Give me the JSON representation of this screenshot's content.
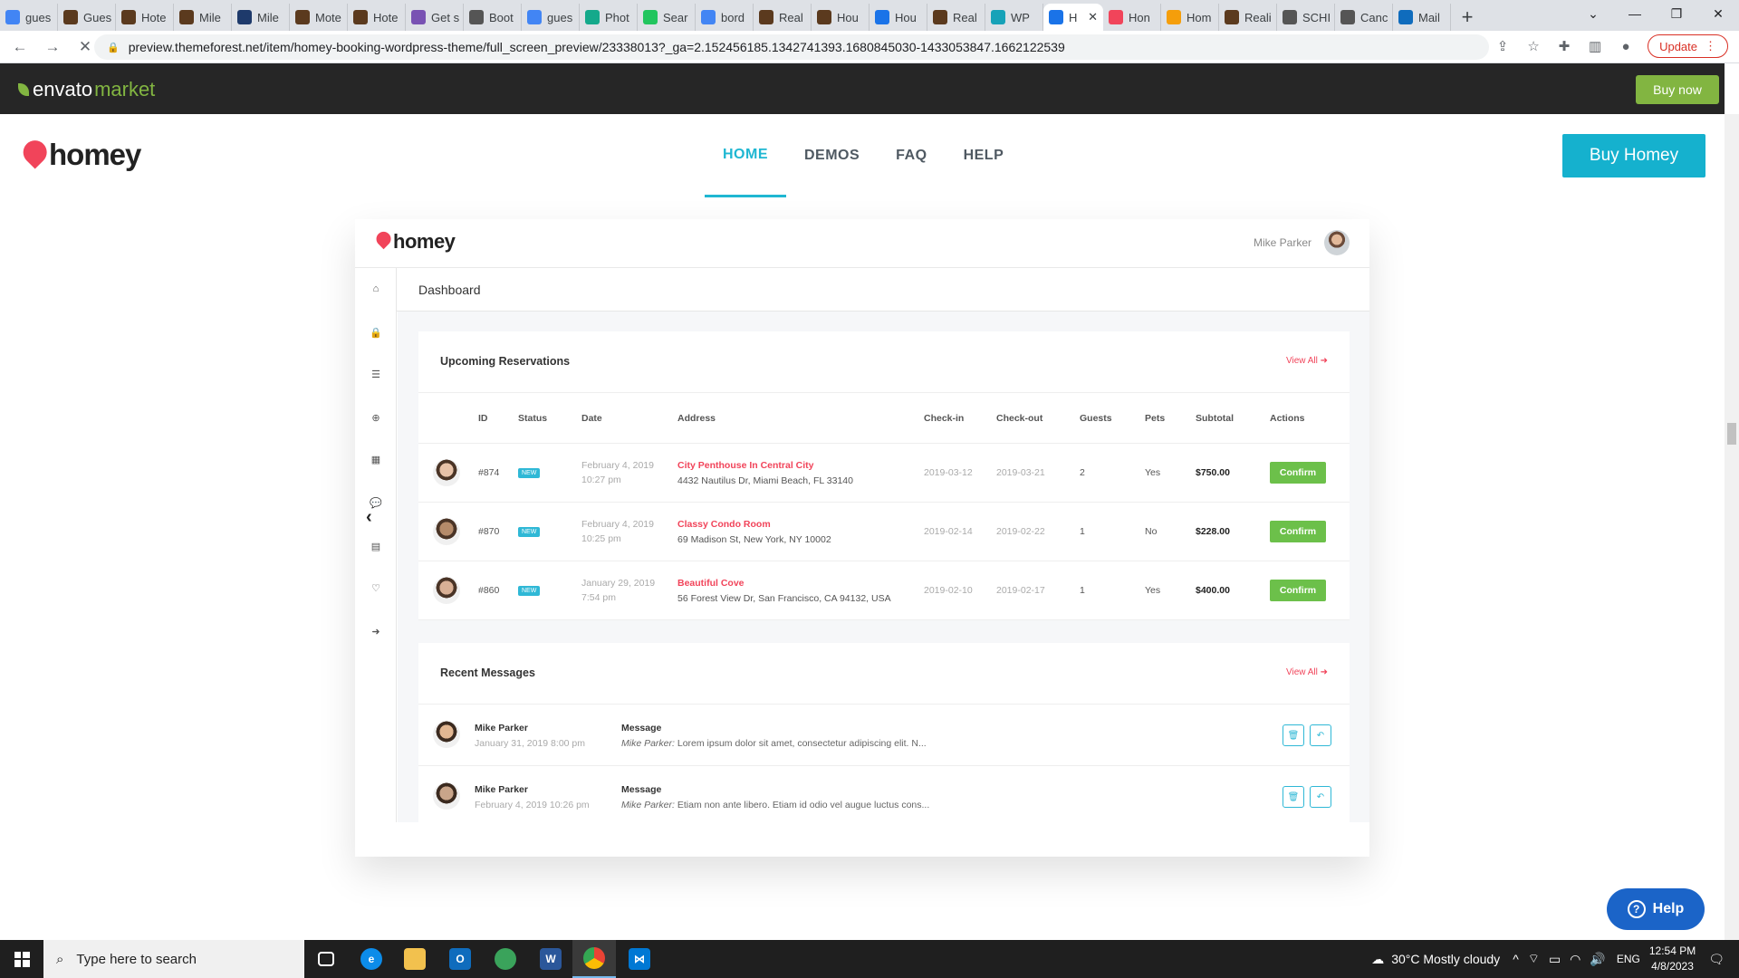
{
  "browser": {
    "tabs": [
      {
        "label": "gues",
        "icon": "google-icon",
        "color": "#4285f4"
      },
      {
        "label": "Gues",
        "icon": "site-icon",
        "color": "#5b3a1e"
      },
      {
        "label": "Hote",
        "icon": "site-icon",
        "color": "#5b3a1e"
      },
      {
        "label": "Mile",
        "icon": "site-icon",
        "color": "#5b3a1e"
      },
      {
        "label": "Mile",
        "icon": "site-icon",
        "color": "#1e3a6b"
      },
      {
        "label": "Mote",
        "icon": "site-icon",
        "color": "#5b3a1e"
      },
      {
        "label": "Hote",
        "icon": "site-icon",
        "color": "#5b3a1e"
      },
      {
        "label": "Get s",
        "icon": "bootstrap-icon",
        "color": "#7952b3"
      },
      {
        "label": "Boot",
        "icon": "globe-icon",
        "color": "#555555"
      },
      {
        "label": "gues",
        "icon": "google-icon",
        "color": "#4285f4"
      },
      {
        "label": "Phot",
        "icon": "site-icon",
        "color": "#14a98b"
      },
      {
        "label": "Sear",
        "icon": "site-icon",
        "color": "#22c55e"
      },
      {
        "label": "bord",
        "icon": "google-icon",
        "color": "#4285f4"
      },
      {
        "label": "Real",
        "icon": "site-icon",
        "color": "#5b3a1e"
      },
      {
        "label": "Hou",
        "icon": "site-icon",
        "color": "#5b3a1e"
      },
      {
        "label": "Hou",
        "icon": "site-icon",
        "color": "#1a73e8"
      },
      {
        "label": "Real",
        "icon": "site-icon",
        "color": "#5b3a1e"
      },
      {
        "label": "WP",
        "icon": "site-icon",
        "color": "#17a2b8"
      },
      {
        "label": "H",
        "icon": "loading-icon",
        "color": "#1a73e8",
        "active": true
      },
      {
        "label": "Hon",
        "icon": "heart-icon",
        "color": "#f1445a"
      },
      {
        "label": "Hom",
        "icon": "heart-icon",
        "color": "#f59e0b"
      },
      {
        "label": "Reali",
        "icon": "site-icon",
        "color": "#5b3a1e"
      },
      {
        "label": "SCHI",
        "icon": "globe-icon",
        "color": "#555555"
      },
      {
        "label": "Canc",
        "icon": "globe-icon",
        "color": "#555555"
      },
      {
        "label": "Mail",
        "icon": "outlook-icon",
        "color": "#0f6cbd"
      }
    ],
    "url": "preview.themeforest.net/item/homey-booking-wordpress-theme/full_screen_preview/23338013?_ga=2.152456185.1342741393.1680845030-1433053847.1662122539",
    "update_label": "Update"
  },
  "envato": {
    "logo_main": "envato",
    "logo_sub": "market",
    "buy_now": "Buy now"
  },
  "site": {
    "logo": "homey",
    "nav": [
      "HOME",
      "DEMOS",
      "FAQ",
      "HELP"
    ],
    "active_nav": "HOME",
    "cta": "Buy Homey"
  },
  "dashboard": {
    "logo": "homey",
    "user_name": "Mike Parker",
    "title": "Dashboard",
    "reservations": {
      "title": "Upcoming Reservations",
      "view_all": "View All",
      "columns": [
        "ID",
        "Status",
        "Date",
        "Address",
        "Check-in",
        "Check-out",
        "Guests",
        "Pets",
        "Subtotal",
        "Actions"
      ],
      "rows": [
        {
          "id": "#874",
          "status": "NEW",
          "date": "February 4, 2019",
          "time": "10:27 pm",
          "name": "City Penthouse In Central City",
          "address": "4432 Nautilus Dr, Miami Beach, FL 33140",
          "checkin": "2019-03-12",
          "checkout": "2019-03-21",
          "guests": "2",
          "pets": "Yes",
          "subtotal": "$750.00",
          "action": "Confirm"
        },
        {
          "id": "#870",
          "status": "NEW",
          "date": "February 4, 2019",
          "time": "10:25 pm",
          "name": "Classy Condo Room",
          "address": "69 Madison St, New York, NY 10002",
          "checkin": "2019-02-14",
          "checkout": "2019-02-22",
          "guests": "1",
          "pets": "No",
          "subtotal": "$228.00",
          "action": "Confirm"
        },
        {
          "id": "#860",
          "status": "NEW",
          "date": "January 29, 2019",
          "time": "7:54 pm",
          "name": "Beautiful Cove",
          "address": "56 Forest View Dr, San Francisco, CA 94132, USA",
          "checkin": "2019-02-10",
          "checkout": "2019-02-17",
          "guests": "1",
          "pets": "Yes",
          "subtotal": "$400.00",
          "action": "Confirm"
        }
      ]
    },
    "messages": {
      "title": "Recent Messages",
      "view_all": "View All",
      "rows": [
        {
          "sender": "Mike Parker",
          "date": "January 31, 2019 8:00 pm",
          "label": "Message",
          "author": "Mike Parker:",
          "text": "Lorem ipsum dolor sit amet, consectetur adipiscing elit. N..."
        },
        {
          "sender": "Mike Parker",
          "date": "February 4, 2019 10:26 pm",
          "label": "Message",
          "author": "Mike Parker:",
          "text": "Etiam non ante libero. Etiam id odio vel augue luctus cons..."
        }
      ]
    }
  },
  "help_label": "Help",
  "taskbar": {
    "search_placeholder": "Type here to search",
    "weather": "30°C  Mostly cloudy",
    "lang": "ENG",
    "time": "12:54 PM",
    "date": "4/8/2023"
  },
  "colors": {
    "accent": "#1fb7d2",
    "brand_red": "#f1445a",
    "confirm_green": "#6cc04a",
    "envato_green": "#82b541"
  }
}
